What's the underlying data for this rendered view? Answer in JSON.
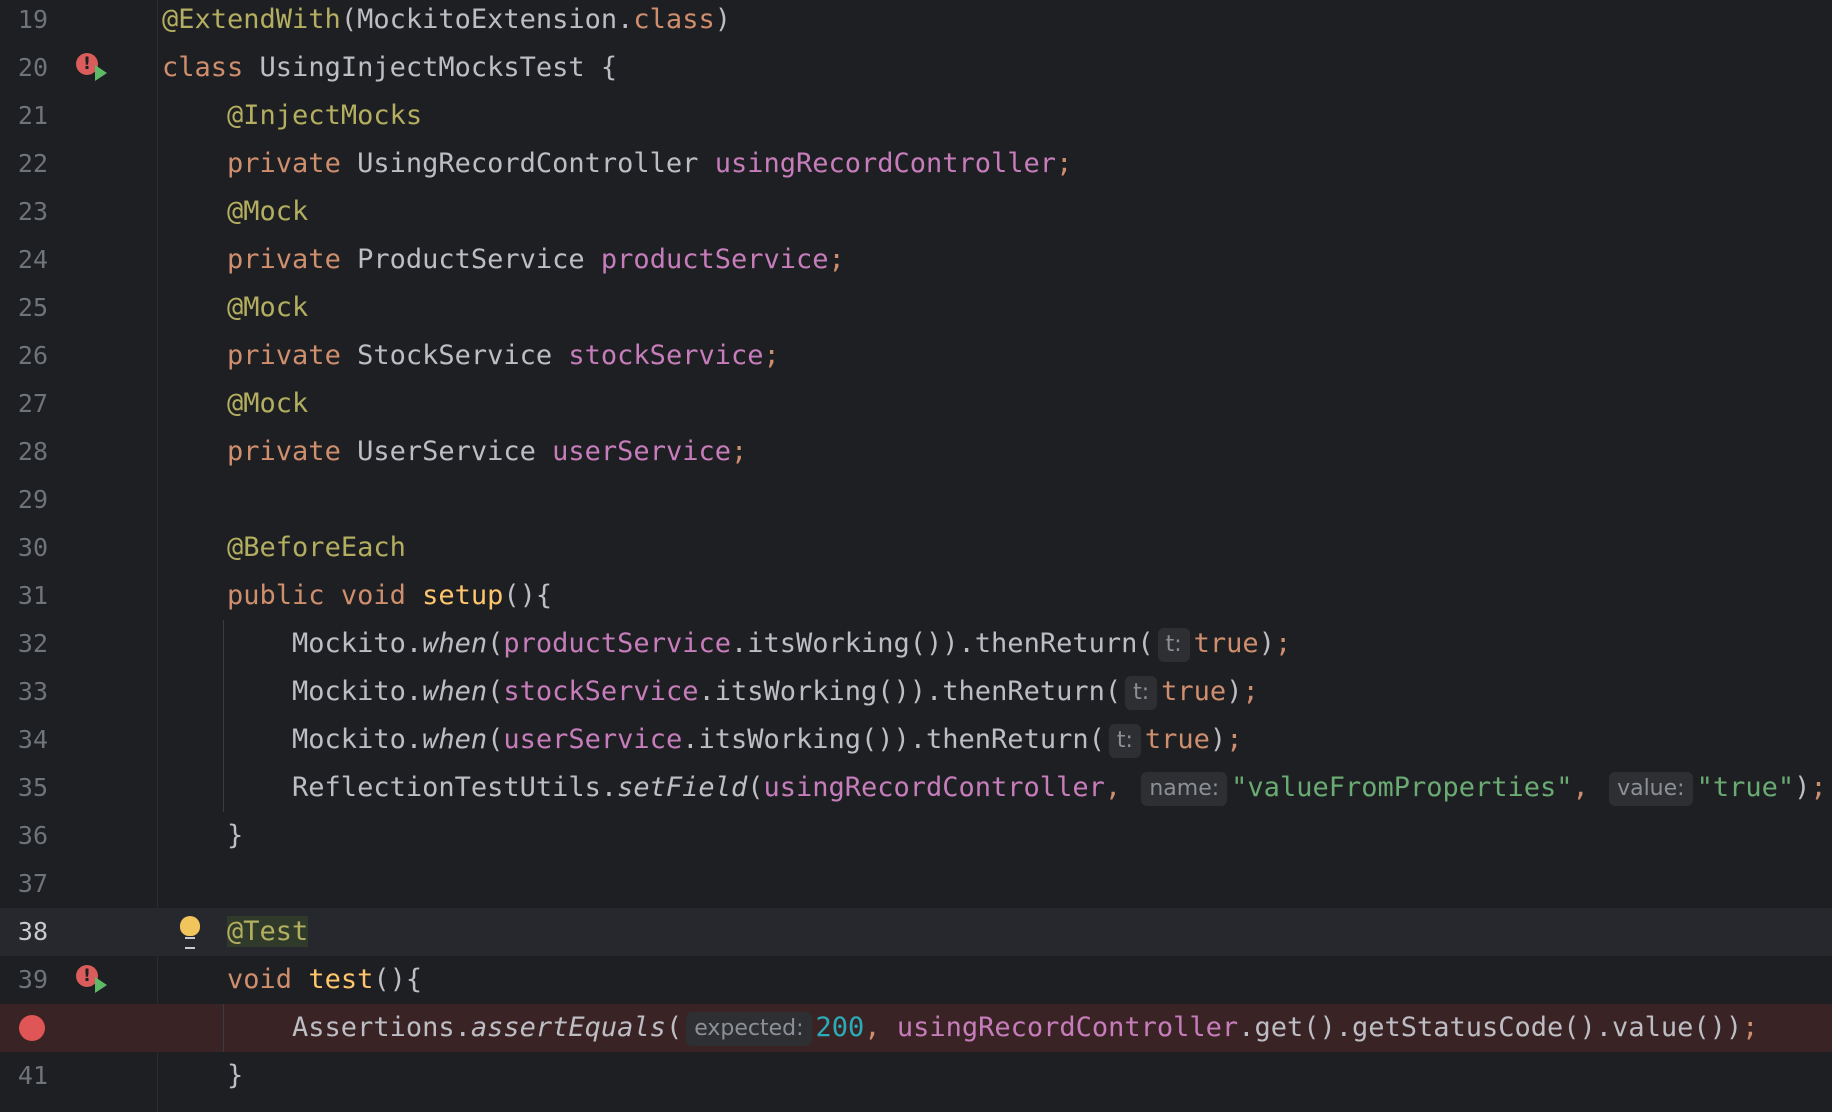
{
  "editor": {
    "lines": [
      {
        "num": "19",
        "tokens": [
          {
            "t": "@ExtendWith",
            "c": "ann"
          },
          {
            "t": "(MockitoExtension.",
            "c": "plain"
          },
          {
            "t": "class",
            "c": "kw"
          },
          {
            "t": ")",
            "c": "plain"
          }
        ]
      },
      {
        "num": "20",
        "tokens": [
          {
            "t": "class ",
            "c": "kw"
          },
          {
            "t": "UsingInjectMocksTest {",
            "c": "plain"
          }
        ]
      },
      {
        "num": "21",
        "tokens": [
          {
            "t": "    "
          },
          {
            "t": "@InjectMocks",
            "c": "ann"
          }
        ]
      },
      {
        "num": "22",
        "tokens": [
          {
            "t": "    "
          },
          {
            "t": "private ",
            "c": "kw"
          },
          {
            "t": "UsingRecordController ",
            "c": "plain"
          },
          {
            "t": "usingRecordController",
            "c": "field"
          },
          {
            "t": ";",
            "c": "kw"
          }
        ]
      },
      {
        "num": "23",
        "tokens": [
          {
            "t": "    "
          },
          {
            "t": "@Mock",
            "c": "ann"
          }
        ]
      },
      {
        "num": "24",
        "tokens": [
          {
            "t": "    "
          },
          {
            "t": "private ",
            "c": "kw"
          },
          {
            "t": "ProductService ",
            "c": "plain"
          },
          {
            "t": "productService",
            "c": "field"
          },
          {
            "t": ";",
            "c": "kw"
          }
        ]
      },
      {
        "num": "25",
        "tokens": [
          {
            "t": "    "
          },
          {
            "t": "@Mock",
            "c": "ann"
          }
        ]
      },
      {
        "num": "26",
        "tokens": [
          {
            "t": "    "
          },
          {
            "t": "private ",
            "c": "kw"
          },
          {
            "t": "StockService ",
            "c": "plain"
          },
          {
            "t": "stockService",
            "c": "field"
          },
          {
            "t": ";",
            "c": "kw"
          }
        ]
      },
      {
        "num": "27",
        "tokens": [
          {
            "t": "    "
          },
          {
            "t": "@Mock",
            "c": "ann"
          }
        ]
      },
      {
        "num": "28",
        "tokens": [
          {
            "t": "    "
          },
          {
            "t": "private ",
            "c": "kw"
          },
          {
            "t": "UserService ",
            "c": "plain"
          },
          {
            "t": "userService",
            "c": "field"
          },
          {
            "t": ";",
            "c": "kw"
          }
        ]
      },
      {
        "num": "29",
        "tokens": []
      },
      {
        "num": "30",
        "tokens": [
          {
            "t": "    "
          },
          {
            "t": "@BeforeEach",
            "c": "ann"
          }
        ]
      },
      {
        "num": "31",
        "tokens": [
          {
            "t": "    "
          },
          {
            "t": "public ",
            "c": "kw"
          },
          {
            "t": "void ",
            "c": "kw"
          },
          {
            "t": "setup",
            "c": "meth"
          },
          {
            "t": "(){",
            "c": "plain"
          }
        ]
      },
      {
        "num": "32",
        "tokens": [
          {
            "t": "        Mockito.",
            "c": "plain"
          },
          {
            "t": "when",
            "c": "plain",
            "i": true
          },
          {
            "t": "(",
            "c": "plain"
          },
          {
            "t": "productService",
            "c": "field"
          },
          {
            "t": ".itsWorking()).thenReturn(",
            "c": "plain"
          },
          {
            "hint": "t:"
          },
          {
            "t": "true",
            "c": "kw"
          },
          {
            "t": ")",
            "c": "plain"
          },
          {
            "t": ";",
            "c": "kw"
          }
        ]
      },
      {
        "num": "33",
        "tokens": [
          {
            "t": "        Mockito.",
            "c": "plain"
          },
          {
            "t": "when",
            "c": "plain",
            "i": true
          },
          {
            "t": "(",
            "c": "plain"
          },
          {
            "t": "stockService",
            "c": "field"
          },
          {
            "t": ".itsWorking()).thenReturn(",
            "c": "plain"
          },
          {
            "hint": "t:"
          },
          {
            "t": "true",
            "c": "kw"
          },
          {
            "t": ")",
            "c": "plain"
          },
          {
            "t": ";",
            "c": "kw"
          }
        ]
      },
      {
        "num": "34",
        "tokens": [
          {
            "t": "        Mockito.",
            "c": "plain"
          },
          {
            "t": "when",
            "c": "plain",
            "i": true
          },
          {
            "t": "(",
            "c": "plain"
          },
          {
            "t": "userService",
            "c": "field"
          },
          {
            "t": ".itsWorking()).thenReturn(",
            "c": "plain"
          },
          {
            "hint": "t:"
          },
          {
            "t": "true",
            "c": "kw"
          },
          {
            "t": ")",
            "c": "plain"
          },
          {
            "t": ";",
            "c": "kw"
          }
        ]
      },
      {
        "num": "35",
        "tokens": [
          {
            "t": "        ReflectionTestUtils.",
            "c": "plain"
          },
          {
            "t": "setField",
            "c": "plain",
            "i": true
          },
          {
            "t": "(",
            "c": "plain"
          },
          {
            "t": "usingRecordController",
            "c": "field"
          },
          {
            "t": ", ",
            "c": "kw"
          },
          {
            "hint": "name:"
          },
          {
            "t": "\"valueFromProperties\"",
            "c": "str"
          },
          {
            "t": ", ",
            "c": "kw"
          },
          {
            "hint": "value:"
          },
          {
            "t": "\"true\"",
            "c": "str"
          },
          {
            "t": ")",
            "c": "plain"
          },
          {
            "t": ";",
            "c": "kw"
          }
        ]
      },
      {
        "num": "36",
        "tokens": [
          {
            "t": "    }",
            "c": "plain"
          }
        ]
      },
      {
        "num": "37",
        "tokens": []
      },
      {
        "num": "38",
        "current": true,
        "tokens": [
          {
            "t": "    "
          },
          {
            "t": "@Test",
            "c": "ann",
            "hl": true
          }
        ]
      },
      {
        "num": "39",
        "tokens": [
          {
            "t": "    "
          },
          {
            "t": "void ",
            "c": "kw"
          },
          {
            "t": "test",
            "c": "meth"
          },
          {
            "t": "(){",
            "c": "plain"
          }
        ]
      },
      {
        "num": "",
        "breakpoint": true,
        "tokens": [
          {
            "t": "        Assertions.",
            "c": "plain"
          },
          {
            "t": "assertEquals",
            "c": "plain",
            "i": true
          },
          {
            "t": "(",
            "c": "plain"
          },
          {
            "hint": "expected:"
          },
          {
            "t": "200",
            "c": "num"
          },
          {
            "t": ", ",
            "c": "kw"
          },
          {
            "t": "usingRecordController",
            "c": "field"
          },
          {
            "t": ".get().getStatusCode().value())",
            "c": "plain"
          },
          {
            "t": ";",
            "c": "kw"
          }
        ]
      },
      {
        "num": "41",
        "tokens": [
          {
            "t": "    }",
            "c": "plain"
          }
        ]
      }
    ]
  },
  "gutter_icons": {
    "error_run_glyph": "!",
    "error_run_lines": [
      "20",
      "39"
    ],
    "bulb_line": "38"
  }
}
